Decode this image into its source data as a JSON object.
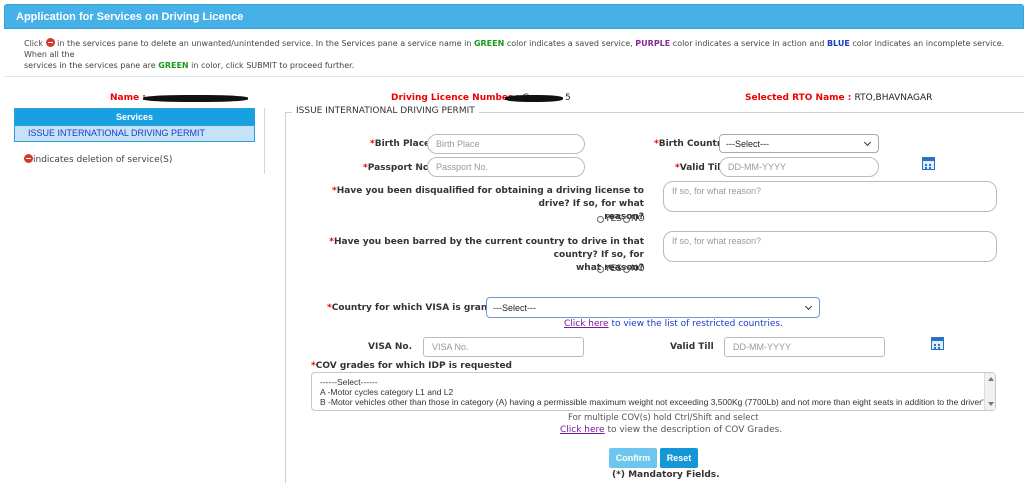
{
  "header": {
    "title": "Application for Services on Driving Licence"
  },
  "info": {
    "p1": "Click ",
    "p2": " in the services pane to delete an unwanted/unintended service. In the Services pane a service name in ",
    "green": "GREEN",
    "p3": " color indicates a saved service, ",
    "purple": "PURPLE",
    "p4": " color indicates a service in action and ",
    "blue": "BLUE",
    "p5": " color indicates an incomplete service. When all the",
    "p6": "services in the services pane are ",
    "green2": "GREEN",
    "p7": " in color, click SUBMIT to proceed further."
  },
  "applicant": {
    "name_label": "Name :",
    "dl_label": "Driving Licence Number :",
    "dl_partial_start": "G",
    "dl_partial_end": "5",
    "rto_label": "Selected RTO Name :",
    "rto_value": "RTO,BHAVNAGAR"
  },
  "services": {
    "title": "Services",
    "items": [
      {
        "label": "ISSUE INTERNATIONAL DRIVING PERMIT"
      }
    ],
    "deletion_note": "indicates deletion of service(S)"
  },
  "form": {
    "legend": "ISSUE INTERNATIONAL DRIVING PERMIT",
    "required_mark": "*",
    "birth_place": {
      "label": "Birth Place",
      "placeholder": "Birth Place"
    },
    "birth_country": {
      "label": "Birth Country",
      "selected": "---Select---"
    },
    "passport": {
      "label": "Passport No.",
      "placeholder": "Passport No."
    },
    "valid_till": {
      "label": "Valid Till",
      "placeholder": "DD-MM-YYYY"
    },
    "disqualified": {
      "label_line1": "Have you been disqualified for obtaining a driving license to drive? If so, for what",
      "label_line2": "reason?",
      "placeholder": "If so, for what reason?",
      "yes": "YES",
      "no": "NO"
    },
    "barred": {
      "label_line1": "Have you been barred by the current country to drive in that country? If so, for",
      "label_line2": "what reason?",
      "placeholder": "If so, for what reason?",
      "yes": "YES",
      "no": "NO"
    },
    "visa_country": {
      "label": "Country for which VISA is granted",
      "selected": "---Select---"
    },
    "restricted_link": {
      "link_text": "Click here",
      "rest": " to view the list of restricted countries."
    },
    "visa_no": {
      "label": "VISA No.",
      "placeholder": "VISA No."
    },
    "visa_valid_till": {
      "label": "Valid Till",
      "placeholder": "DD-MM-YYYY"
    },
    "cov": {
      "label": "COV grades for which IDP is requested",
      "options": [
        "------Select------",
        "A -Motor cycles category L1 and L2",
        "B -Motor vehicles other than those in category (A) having a permissible maximum weight not exceeding 3,500Kg (7700Lb) and not more than eight seats in addition to the driver's seat"
      ],
      "hint": "For multiple COV(s) hold Ctrl/Shift and select",
      "link_text": "Click here",
      "link_rest": " to view the description of COV Grades."
    },
    "confirm": "Confirm",
    "reset": "Reset",
    "mandatory": "(*) Mandatory Fields."
  }
}
